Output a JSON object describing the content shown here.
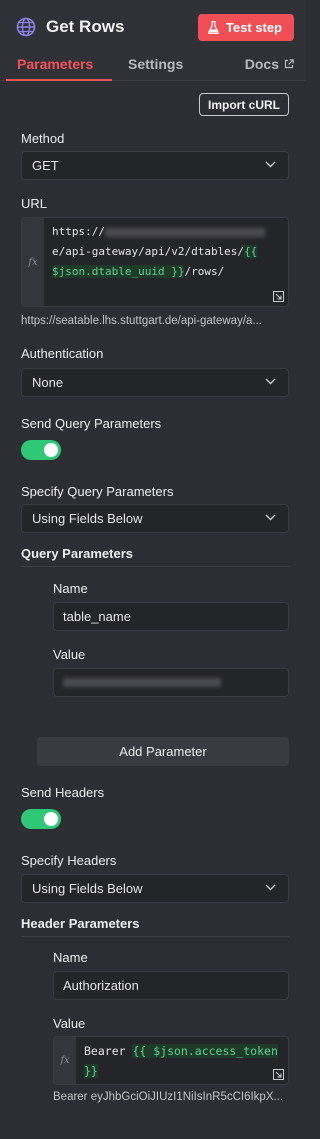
{
  "header": {
    "title": "Get Rows",
    "icon": "globe-icon",
    "test_button": "Test step",
    "accent": "#f04f56"
  },
  "tabs": [
    {
      "label": "Parameters",
      "active": true
    },
    {
      "label": "Settings",
      "active": false
    },
    {
      "label": "Docs",
      "active": false
    }
  ],
  "import_curl": "Import cURL",
  "method": {
    "label": "Method",
    "value": "GET"
  },
  "url": {
    "label": "URL",
    "line1_prefix": "https://",
    "line2_text": "e/api-gateway/api/v2/dtables/",
    "expr_open": "{{",
    "line3_expr": "$json.dtable_uuid }}",
    "line3_suffix": "/rows/",
    "resolved": "https://seatable.lhs.stuttgart.de/api-gateway/a..."
  },
  "authentication": {
    "label": "Authentication",
    "value": "None"
  },
  "send_query": {
    "label": "Send Query Parameters",
    "enabled": true
  },
  "specify_query": {
    "label": "Specify Query Parameters",
    "value": "Using Fields Below"
  },
  "query_params": {
    "title": "Query Parameters",
    "name_label": "Name",
    "name_value": "table_name",
    "value_label": "Value",
    "add_button": "Add Parameter"
  },
  "send_headers": {
    "label": "Send Headers",
    "enabled": true
  },
  "specify_headers": {
    "label": "Specify Headers",
    "value": "Using Fields Below"
  },
  "header_params": {
    "title": "Header Parameters",
    "name_label": "Name",
    "name_value": "Authorization",
    "value_label": "Value",
    "value_prefix": "Bearer ",
    "value_expr_line1": "{{ $json.access_token",
    "value_expr_line2": "}}",
    "resolved": "Bearer eyJhbGciOiJIUzI1NiIsInR5cCI6IkpX..."
  },
  "colors": {
    "toggle_on": "#2ec877",
    "expression": "#5bd18b"
  }
}
